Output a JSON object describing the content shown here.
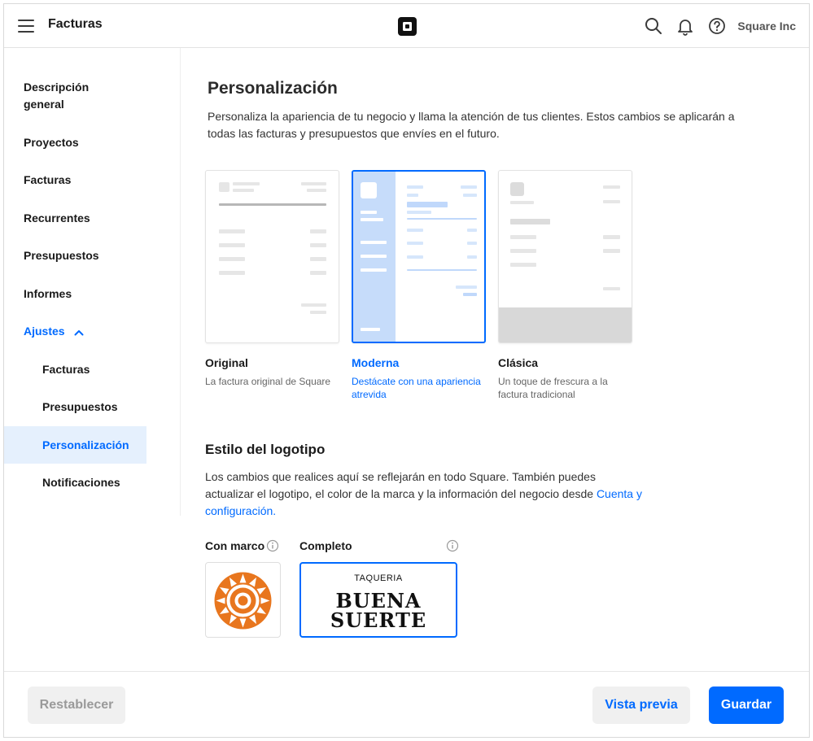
{
  "header": {
    "app_title": "Facturas",
    "company": "Square Inc"
  },
  "sidebar": {
    "items": [
      {
        "label": "Descripción general"
      },
      {
        "label": "Proyectos"
      },
      {
        "label": "Facturas"
      },
      {
        "label": "Recurrentes"
      },
      {
        "label": "Presupuestos"
      },
      {
        "label": "Informes"
      },
      {
        "label": "Ajustes"
      }
    ],
    "subitems": [
      {
        "label": "Facturas"
      },
      {
        "label": "Presupuestos"
      },
      {
        "label": "Personalización"
      },
      {
        "label": "Notificaciones"
      }
    ]
  },
  "main": {
    "title": "Personalización",
    "intro": "Personaliza la apariencia de tu negocio y llama la atención de tus clientes. Estos cambios se aplicarán a todas las facturas y presupuestos que envíes en el futuro.",
    "templates": [
      {
        "name": "Original",
        "description": "La factura original de Square"
      },
      {
        "name": "Moderna",
        "description": "Destácate con una apariencia atrevida",
        "selected": true
      },
      {
        "name": "Clásica",
        "description": "Un toque de frescura a la factura tradicional"
      }
    ],
    "logo_section": {
      "title": "Estilo del logotipo",
      "text": "Los cambios que realices aquí se reflejarán en todo Square. También puedes actualizar el logotipo, el color de la marca y la información del negocio desde ",
      "link": "Cuenta y configuración.",
      "options": [
        {
          "label": "Con marco"
        },
        {
          "label": "Completo",
          "selected": true
        }
      ],
      "logo_small_text": "TAQUERIA",
      "logo_line1": "BUENA",
      "logo_line2": "SUERTE"
    }
  },
  "footer": {
    "reset": "Restablecer",
    "preview": "Vista previa",
    "save": "Guardar"
  },
  "colors": {
    "accent": "#006aff",
    "logo_orange": "#e8761e"
  }
}
